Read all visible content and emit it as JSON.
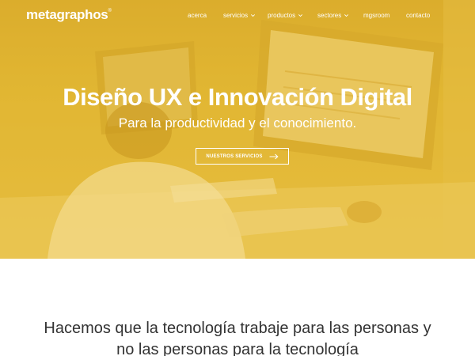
{
  "brand": {
    "logo_text": "metagraphos",
    "logo_mark": "®"
  },
  "nav": {
    "items": [
      {
        "label": "acerca",
        "dropdown": false
      },
      {
        "label": "servicios",
        "dropdown": true
      },
      {
        "label": "productos",
        "dropdown": true
      },
      {
        "label": "sectores",
        "dropdown": true
      },
      {
        "label": "mgsroom",
        "dropdown": false
      },
      {
        "label": "contacto",
        "dropdown": false
      }
    ]
  },
  "hero": {
    "title": "Diseño UX e Innovación Digital",
    "subtitle": "Para la productividad y el conocimiento.",
    "cta_label": "NUESTROS SERVICIOS",
    "cta_icon": "arrow-right-icon",
    "overlay_color": "#e3b73a"
  },
  "mission": {
    "line1": "Hacemos que la tecnología trabaje para las personas y",
    "line2": "no las personas para la tecnología"
  },
  "colors": {
    "hero_yellow": "#e3b73a",
    "text_white": "#ffffff",
    "body_text": "#333333"
  }
}
